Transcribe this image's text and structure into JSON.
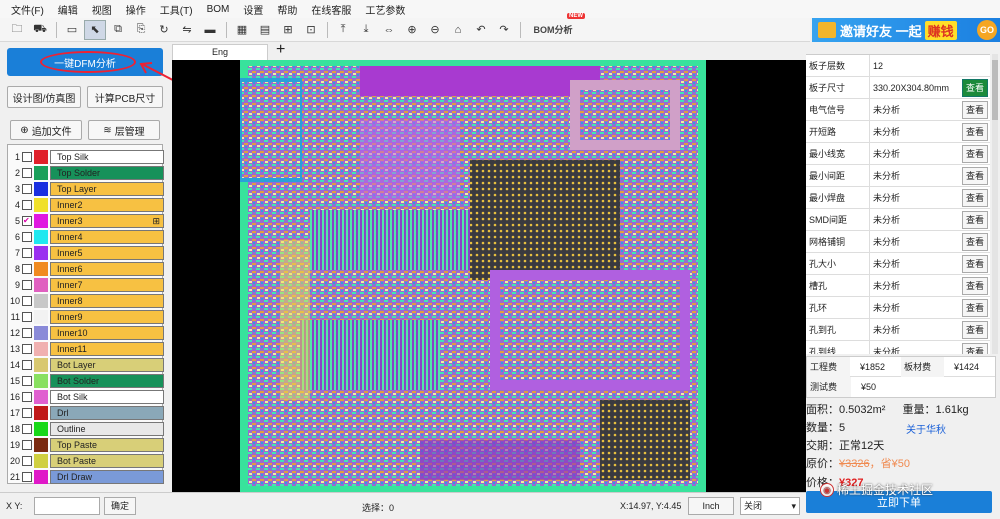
{
  "menu": [
    "文件(F)",
    "编辑",
    "视图",
    "操作",
    "工具(T)",
    "BOM",
    "设置",
    "帮助",
    "在线客服",
    "工艺参数"
  ],
  "toolbar": {
    "bom_label": "BOM分析",
    "bom_badge": "NEW"
  },
  "invite": {
    "text": "邀请好友 一起",
    "earn": "赚钱",
    "go": "GO"
  },
  "left": {
    "dfm_button": "一键DFM分析",
    "design_sim": "设计图/仿真图",
    "calc_pcb": "计算PCB尺寸",
    "add_file": "追加文件",
    "layer_mgmt": "层管理",
    "layers": [
      {
        "n": "1",
        "name": "Top Silk",
        "color": "#e0202a",
        "bg": "#ffffff",
        "checked": false
      },
      {
        "n": "2",
        "name": "Top Solder",
        "color": "#1aa05a",
        "bg": "#17915a",
        "checked": false
      },
      {
        "n": "3",
        "name": "Top Layer",
        "color": "#1a2fe0",
        "bg": "#f7c142",
        "checked": false
      },
      {
        "n": "4",
        "name": "Inner2",
        "color": "#f0e02a",
        "bg": "#f7c142",
        "checked": false
      },
      {
        "n": "5",
        "name": "Inner3",
        "color": "#e018e0",
        "bg": "#f7c142",
        "checked": true,
        "extra": "⊞"
      },
      {
        "n": "6",
        "name": "Inner4",
        "color": "#20e8f0",
        "bg": "#f7c142",
        "checked": false
      },
      {
        "n": "7",
        "name": "Inner5",
        "color": "#9a30f0",
        "bg": "#f7c142",
        "checked": false
      },
      {
        "n": "8",
        "name": "Inner6",
        "color": "#f08a20",
        "bg": "#f7c142",
        "checked": false
      },
      {
        "n": "9",
        "name": "Inner7",
        "color": "#e060c0",
        "bg": "#f7c142",
        "checked": false
      },
      {
        "n": "10",
        "name": "Inner8",
        "color": "#c8c8c8",
        "bg": "#f7c142",
        "checked": false
      },
      {
        "n": "11",
        "name": "Inner9",
        "color": "#f2f2f2",
        "bg": "#f7c142",
        "checked": false
      },
      {
        "n": "12",
        "name": "Inner10",
        "color": "#8a8ad8",
        "bg": "#f7c142",
        "checked": false
      },
      {
        "n": "13",
        "name": "Inner11",
        "color": "#f0b0b0",
        "bg": "#f7c142",
        "checked": false
      },
      {
        "n": "14",
        "name": "Bot Layer",
        "color": "#d8c870",
        "bg": "#d8cf78",
        "checked": false
      },
      {
        "n": "15",
        "name": "Bot Solder",
        "color": "#88e060",
        "bg": "#17915a",
        "checked": false
      },
      {
        "n": "16",
        "name": "Bot Silk",
        "color": "#e060d0",
        "bg": "#ffffff",
        "checked": false
      },
      {
        "n": "17",
        "name": "Drl",
        "color": "#c01818",
        "bg": "#8aa8b8",
        "checked": false
      },
      {
        "n": "18",
        "name": "Outline",
        "color": "#18d818",
        "bg": "#e8e8e8",
        "checked": false
      },
      {
        "n": "19",
        "name": "Top Paste",
        "color": "#7a2a10",
        "bg": "#d8cf78",
        "checked": false
      },
      {
        "n": "20",
        "name": "Bot Paste",
        "color": "#d0d040",
        "bg": "#d8cf78",
        "checked": false
      },
      {
        "n": "21",
        "name": "Drl Draw",
        "color": "#e018c8",
        "bg": "#7a9ad8",
        "checked": false
      }
    ]
  },
  "tab": {
    "label": "Eng",
    "add": "+"
  },
  "right": {
    "rows": [
      {
        "k": "板子层数",
        "v": "12",
        "btn": ""
      },
      {
        "k": "板子尺寸",
        "v": "330.20X304.80mm",
        "btn": "查看",
        "green": true
      },
      {
        "k": "电气信号",
        "v": "未分析",
        "btn": "查看"
      },
      {
        "k": "开短路",
        "v": "未分析",
        "btn": "查看"
      },
      {
        "k": "最小线宽",
        "v": "未分析",
        "btn": "查看"
      },
      {
        "k": "最小间距",
        "v": "未分析",
        "btn": "查看"
      },
      {
        "k": "最小焊盘",
        "v": "未分析",
        "btn": "查看"
      },
      {
        "k": "SMD间距",
        "v": "未分析",
        "btn": "查看"
      },
      {
        "k": "网格铺铜",
        "v": "未分析",
        "btn": "查看"
      },
      {
        "k": "孔大小",
        "v": "未分析",
        "btn": "查看"
      },
      {
        "k": "槽孔",
        "v": "未分析",
        "btn": "查看"
      },
      {
        "k": "孔环",
        "v": "未分析",
        "btn": "查看"
      },
      {
        "k": "孔到孔",
        "v": "未分析",
        "btn": "查看"
      },
      {
        "k": "孔到线",
        "v": "未分析",
        "btn": "查看"
      }
    ],
    "fees": {
      "eng_k": "工程费",
      "eng_v": "¥1852",
      "mat_k": "板材费",
      "mat_v": "¥1424",
      "test_k": "测试费",
      "test_v": "¥50"
    },
    "area": "面积：0.5032m²",
    "weight": "重量：1.61kg",
    "qty": "数量：5",
    "about": "关于华秋",
    "delivery": "交期：正常12天",
    "orig_k": "原价：",
    "orig_v": "¥3326",
    "save": "，省¥50",
    "price_k": "价格：",
    "price_v": "¥327",
    "order": "立即下单"
  },
  "status": {
    "xy_label": "X Y:",
    "ok": "确定",
    "select": "选择：0",
    "coords": "X:14.97, Y:4.45",
    "unit": "Inch",
    "close": "关闭"
  },
  "watermark": "稀土掘金技术社区"
}
